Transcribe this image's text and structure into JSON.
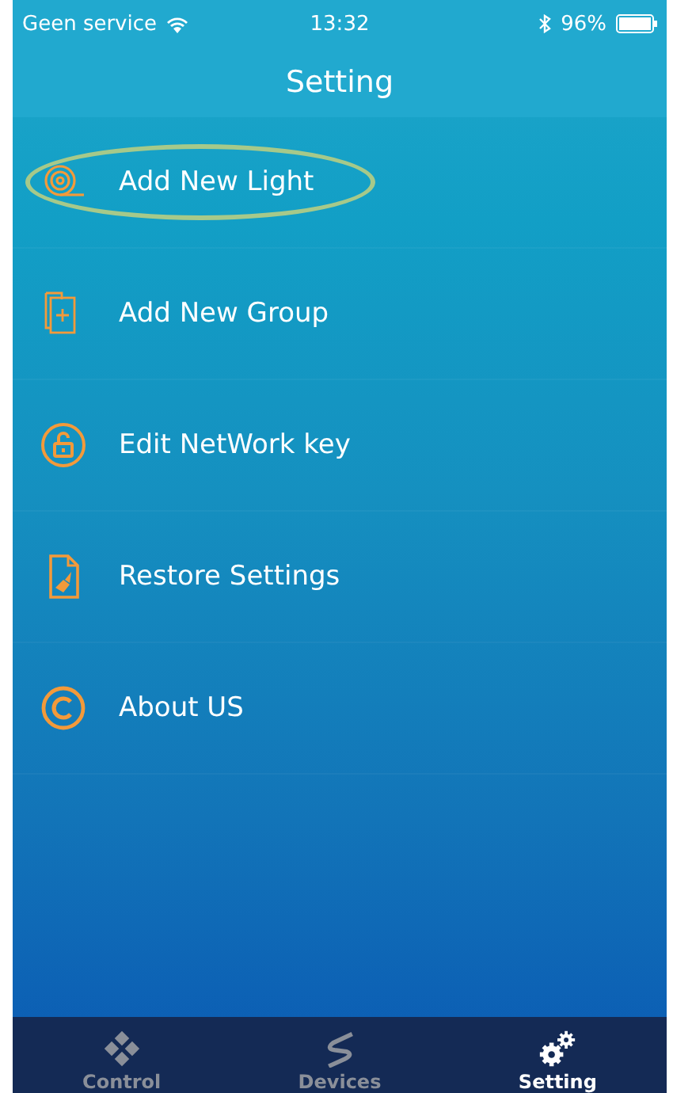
{
  "status_bar": {
    "carrier": "Geen service",
    "time": "13:32",
    "battery": "96%"
  },
  "header": {
    "title": "Setting"
  },
  "menu": [
    {
      "label": "Add New Light",
      "kind": "light",
      "highlighted": true
    },
    {
      "label": "Add New Group",
      "kind": "group",
      "highlighted": false
    },
    {
      "label": "Edit NetWork key",
      "kind": "lock",
      "highlighted": false
    },
    {
      "label": "Restore Settings",
      "kind": "restore",
      "highlighted": false
    },
    {
      "label": "About US",
      "kind": "about",
      "highlighted": false
    }
  ],
  "tabs": [
    {
      "label": "Control",
      "kind": "control",
      "selected": false
    },
    {
      "label": "Devices",
      "kind": "devices",
      "selected": false
    },
    {
      "label": "Setting",
      "kind": "setting",
      "selected": true
    }
  ]
}
